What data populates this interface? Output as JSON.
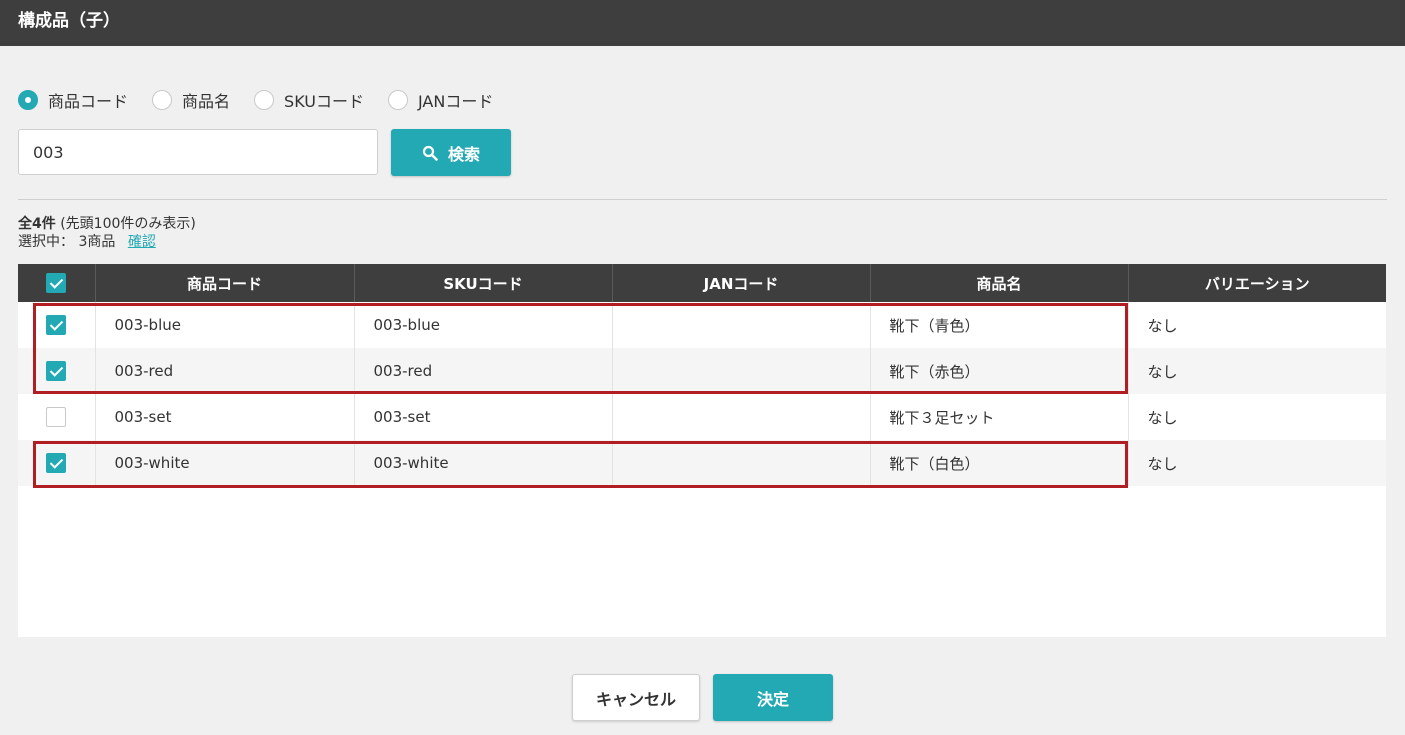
{
  "header": {
    "title": "構成品（子）"
  },
  "search": {
    "options": [
      {
        "label": "商品コード",
        "checked": true
      },
      {
        "label": "商品名",
        "checked": false
      },
      {
        "label": "SKUコード",
        "checked": false
      },
      {
        "label": "JANコード",
        "checked": false
      }
    ],
    "value": "003",
    "button_label": "検索"
  },
  "summary": {
    "total": "全4件",
    "note": "(先頭100件のみ表示)",
    "selected_prefix": "選択中：",
    "selected_count": "3商品",
    "confirm_link": "確認"
  },
  "table": {
    "columns": [
      "商品コード",
      "SKUコード",
      "JANコード",
      "商品名",
      "バリエーション"
    ],
    "header_checked": true,
    "rows": [
      {
        "checked": true,
        "code": "003-blue",
        "sku": "003-blue",
        "jan": "",
        "name": "靴下（青色）",
        "variation": "なし"
      },
      {
        "checked": true,
        "code": "003-red",
        "sku": "003-red",
        "jan": "",
        "name": "靴下（赤色）",
        "variation": "なし"
      },
      {
        "checked": false,
        "code": "003-set",
        "sku": "003-set",
        "jan": "",
        "name": "靴下３足セット",
        "variation": "なし"
      },
      {
        "checked": true,
        "code": "003-white",
        "sku": "003-white",
        "jan": "",
        "name": "靴下（白色）",
        "variation": "なし"
      }
    ]
  },
  "footer": {
    "cancel_label": "キャンセル",
    "ok_label": "決定"
  },
  "colors": {
    "accent": "#23a9b3",
    "header_bg": "#3e3e3e",
    "highlight": "#b01e23"
  }
}
